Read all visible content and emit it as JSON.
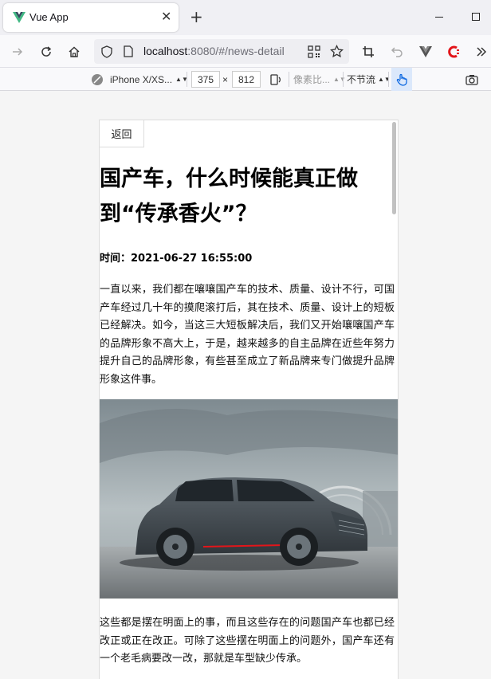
{
  "browser": {
    "tab_title": "Vue App",
    "close_glyph": "✕",
    "new_tab_glyph": "+",
    "url_host": "localhost",
    "url_rest": ":8080/#/news-detail"
  },
  "devtools": {
    "device": "iPhone X/XS...",
    "width": "375",
    "times": "×",
    "height": "812",
    "dpr": "像素比...",
    "throttle": "不节流"
  },
  "page": {
    "back_label": "返回",
    "title": "国产车，什么时候能真正做到“传承香火”？",
    "time": "时间：2021-06-27 16:55:00",
    "paragraph1": "一直以来，我们都在嚷嚷国产车的技术、质量、设计不行，可国产车经过几十年的摸爬滚打后，其在技术、质量、设计上的短板已经解决。如今，当这三大短板解决后，我们又开始嚷嚷国产车的品牌形象不高大上，于是，越来越多的自主品牌在近些年努力提升自己的品牌形象，有些甚至成立了新品牌来专门做提升品牌形象这件事。",
    "paragraph2": "这些都是摆在明面上的事，而且这些存在的问题国产车也都已经改正或正在改正。可除了这些摆在明面上的问题外，国产车还有一个老毛病要改一改，那就是车型缺少传承。"
  },
  "colors": {
    "vue_green": "#41b883",
    "vue_dark": "#35495e",
    "accent_red": "#e3151a"
  }
}
